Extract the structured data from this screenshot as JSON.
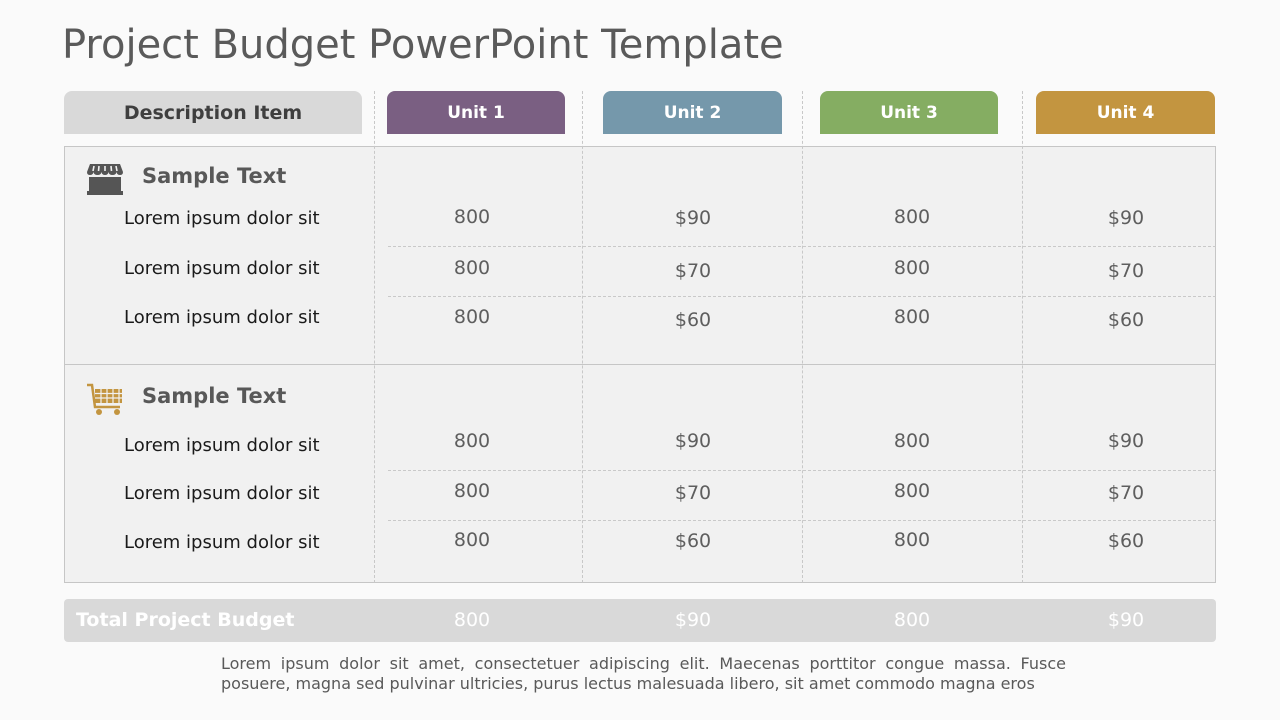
{
  "title": "Project Budget PowerPoint Template",
  "header": {
    "description": "Description Item",
    "units": [
      {
        "label": "Unit 1",
        "color": "#7a5f82"
      },
      {
        "label": "Unit 2",
        "color": "#7598ab"
      },
      {
        "label": "Unit 3",
        "color": "#85ad62"
      },
      {
        "label": "Unit 4",
        "color": "#c39540"
      }
    ]
  },
  "sections": [
    {
      "heading": "Sample Text",
      "icon": "store-icon",
      "rows": [
        {
          "label": "Lorem ipsum dolor sit",
          "values": [
            "800",
            "$90",
            "800",
            "$90"
          ]
        },
        {
          "label": "Lorem ipsum dolor sit",
          "values": [
            "800",
            "$70",
            "800",
            "$70"
          ]
        },
        {
          "label": "Lorem ipsum dolor sit",
          "values": [
            "800",
            "$60",
            "800",
            "$60"
          ]
        }
      ]
    },
    {
      "heading": "Sample Text",
      "icon": "shopping-cart-icon",
      "rows": [
        {
          "label": "Lorem ipsum dolor sit",
          "values": [
            "800",
            "$90",
            "800",
            "$90"
          ]
        },
        {
          "label": "Lorem ipsum dolor sit",
          "values": [
            "800",
            "$70",
            "800",
            "$70"
          ]
        },
        {
          "label": "Lorem ipsum dolor sit",
          "values": [
            "800",
            "$60",
            "800",
            "$60"
          ]
        }
      ]
    }
  ],
  "total": {
    "label": "Total Project Budget",
    "values": [
      "800",
      "$90",
      "800",
      "$90"
    ]
  },
  "footer": "Lorem ipsum dolor sit amet, consectetuer adipiscing elit. Maecenas porttitor congue massa. Fusce posuere, magna sed pulvinar ultricies, purus lectus malesuada libero, sit amet commodo magna eros"
}
